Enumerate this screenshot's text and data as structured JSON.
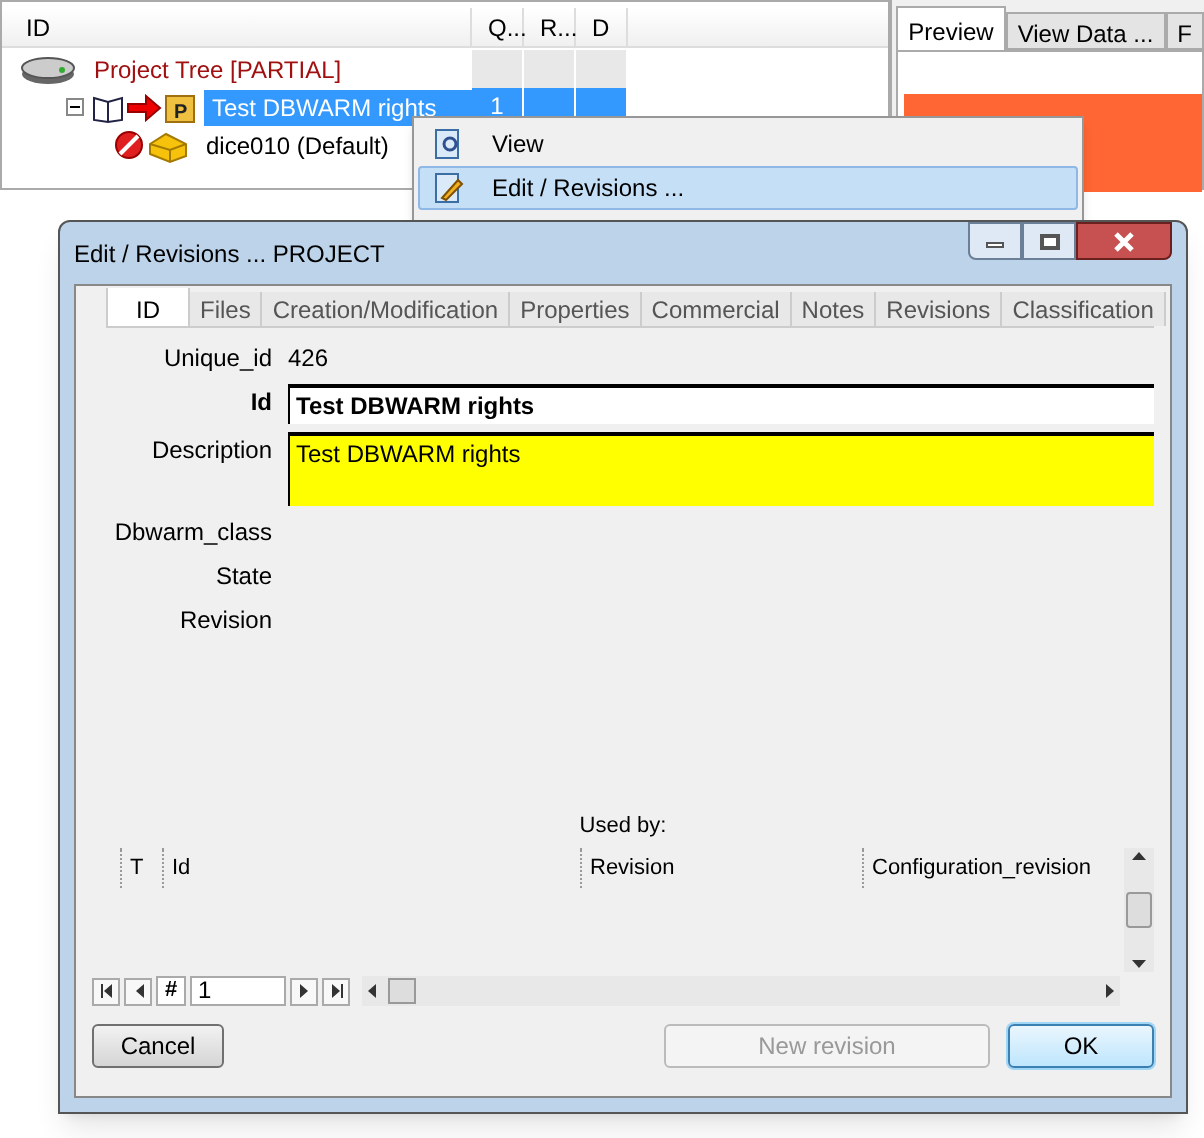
{
  "tree_panel": {
    "columns": [
      "ID",
      "Q...",
      "R...",
      "D"
    ],
    "nodes": [
      {
        "label": "Project Tree [PARTIAL]",
        "kind": "root",
        "selected": false,
        "children": [
          {
            "label": "Test DBWARM rights",
            "kind": "project",
            "icon_letter": "P",
            "selected": true,
            "cells": [
              "1"
            ],
            "children": [
              {
                "label": "dice010 (Default)",
                "kind": "part",
                "selected": false
              }
            ]
          }
        ]
      }
    ]
  },
  "preview_panel": {
    "tabs": [
      {
        "label": "Preview",
        "selected": true
      },
      {
        "label": "View Data ...",
        "selected": false
      },
      {
        "label": "F",
        "selected": false
      }
    ]
  },
  "context_menu": {
    "items": [
      {
        "label": "View",
        "kind": "view",
        "selected": false
      },
      {
        "label": "Edit / Revisions ...",
        "kind": "edit",
        "selected": true
      }
    ]
  },
  "dialog": {
    "title": "Edit / Revisions ... PROJECT",
    "tabs": [
      {
        "label": "ID",
        "selected": true
      },
      {
        "label": "Files",
        "selected": false
      },
      {
        "label": "Creation/Modification",
        "selected": false
      },
      {
        "label": "Properties",
        "selected": false
      },
      {
        "label": "Commercial",
        "selected": false
      },
      {
        "label": "Notes",
        "selected": false
      },
      {
        "label": "Revisions",
        "selected": false
      },
      {
        "label": "Classification",
        "selected": false
      }
    ],
    "fields": [
      {
        "label": "Unique_id",
        "kind": "text",
        "value": "426"
      },
      {
        "label": "Id",
        "kind": "input",
        "value": "Test DBWARM rights"
      },
      {
        "label": "Description",
        "kind": "memo",
        "value": "Test DBWARM rights"
      },
      {
        "label": "Dbwarm_class",
        "kind": "text"
      },
      {
        "label": "State",
        "kind": "text"
      },
      {
        "label": "Revision",
        "kind": "text"
      }
    ],
    "used_by": {
      "title": "Used by:",
      "columns": [
        "T",
        "Id",
        "Revision",
        "Configuration_revision"
      ]
    },
    "navigator": {
      "goto": "#",
      "record": "1"
    },
    "buttons": [
      {
        "label": "Cancel",
        "kind": "normal",
        "disabled": false
      },
      {
        "label": "New revision",
        "kind": "normal",
        "disabled": true
      },
      {
        "label": "OK",
        "kind": "default",
        "disabled": false
      }
    ]
  }
}
